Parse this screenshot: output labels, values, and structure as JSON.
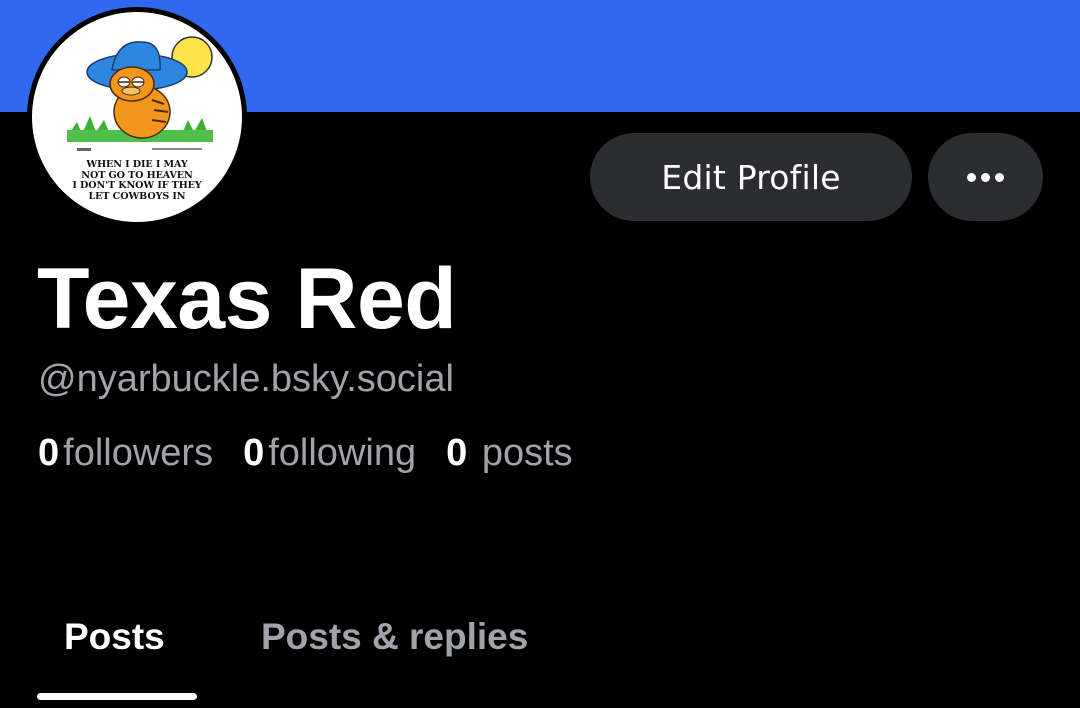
{
  "colors": {
    "banner": "#3068f0",
    "background": "#000000",
    "button_bg": "#2b2d31",
    "muted_text": "#a1a3aa"
  },
  "avatar": {
    "caption_lines": [
      "WHEN I DIE I MAY",
      "NOT GO TO HEAVEN",
      "I DON'T KNOW IF THEY",
      "LET COWBOYS IN"
    ]
  },
  "actions": {
    "edit_profile_label": "Edit Profile",
    "more_icon": "more-horizontal-icon"
  },
  "profile": {
    "display_name": "Texas Red",
    "handle": "@nyarbuckle.bsky.social"
  },
  "stats": {
    "followers_count": "0",
    "followers_label": "followers",
    "following_count": "0",
    "following_label": "following",
    "posts_count": "0",
    "posts_label": "posts"
  },
  "tabs": [
    {
      "label": "Posts",
      "selected": true
    },
    {
      "label": "Posts & replies",
      "selected": false
    }
  ]
}
